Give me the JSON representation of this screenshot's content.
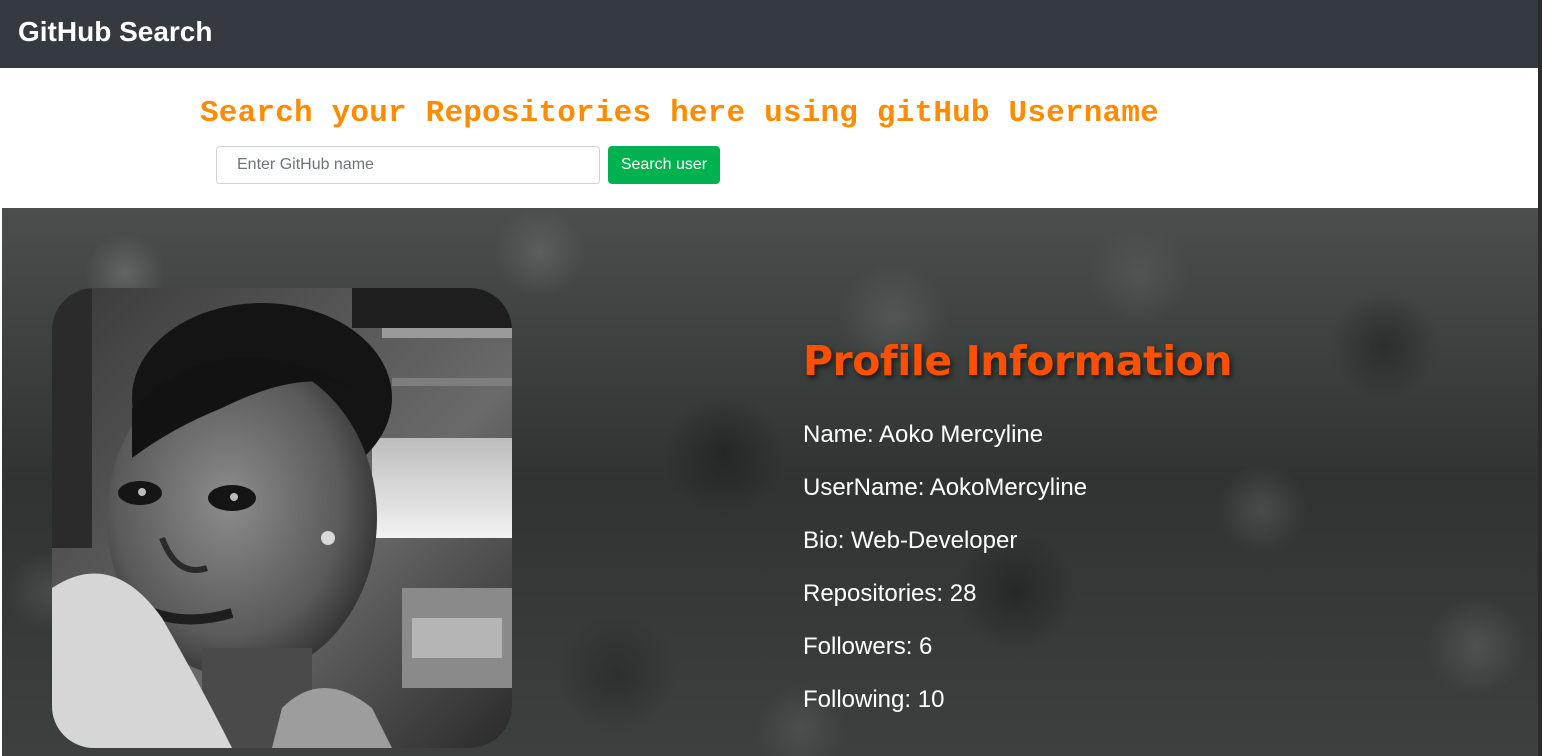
{
  "navbar": {
    "brand": "GitHub Search"
  },
  "search": {
    "heading": "Search your Repositories here using gitHub Username",
    "placeholder": "Enter GitHub name",
    "value": "",
    "button_label": "Search user",
    "button_color": "#00b24f",
    "heading_color": "#ff8c00"
  },
  "profile": {
    "title": "Profile Information",
    "title_color": "#ff4f00",
    "name": "Name: Aoko Mercyline",
    "username": "UserName: AokoMercyline",
    "bio": "Bio: Web-Developer",
    "repositories": "Repositories: 28",
    "followers": "Followers: 6",
    "following": "Following: 10"
  }
}
